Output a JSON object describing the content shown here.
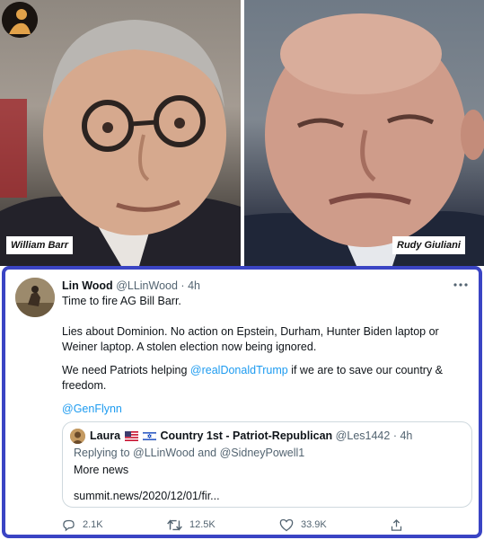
{
  "photos": {
    "left_caption": "William Barr",
    "right_caption": "Rudy Giuliani"
  },
  "tweet": {
    "name": "Lin Wood",
    "handle": "@LLinWood",
    "separator": "·",
    "time": "4h",
    "line1": "Time to fire AG Bill Barr.",
    "line2": "Lies about Dominion. No action on Epstein, Durham, Hunter Biden laptop or Weiner laptop. A stolen election now being ignored.",
    "line3_before": "We need Patriots helping ",
    "line3_mention": "@realDonaldTrump",
    "line3_after": " if we are to save our country & freedom.",
    "mention2": "@GenFlynn",
    "quote": {
      "name": "Laura",
      "name_suffix": "Country 1st - Patriot-Republican",
      "handle": "@Les1442",
      "separator": "·",
      "time": "4h",
      "reply_prefix": "Replying to ",
      "reply_user1": "@LLinWood",
      "reply_and": " and ",
      "reply_user2": "@SidneyPowell1",
      "text": "More news",
      "url": "summit.news/2020/12/01/fir..."
    },
    "actions": {
      "replies": "2.1K",
      "retweets": "12.5K",
      "likes": "33.9K"
    }
  },
  "colors": {
    "border": "#3a44c4",
    "link": "#1d9bf0",
    "muted": "#536471"
  }
}
